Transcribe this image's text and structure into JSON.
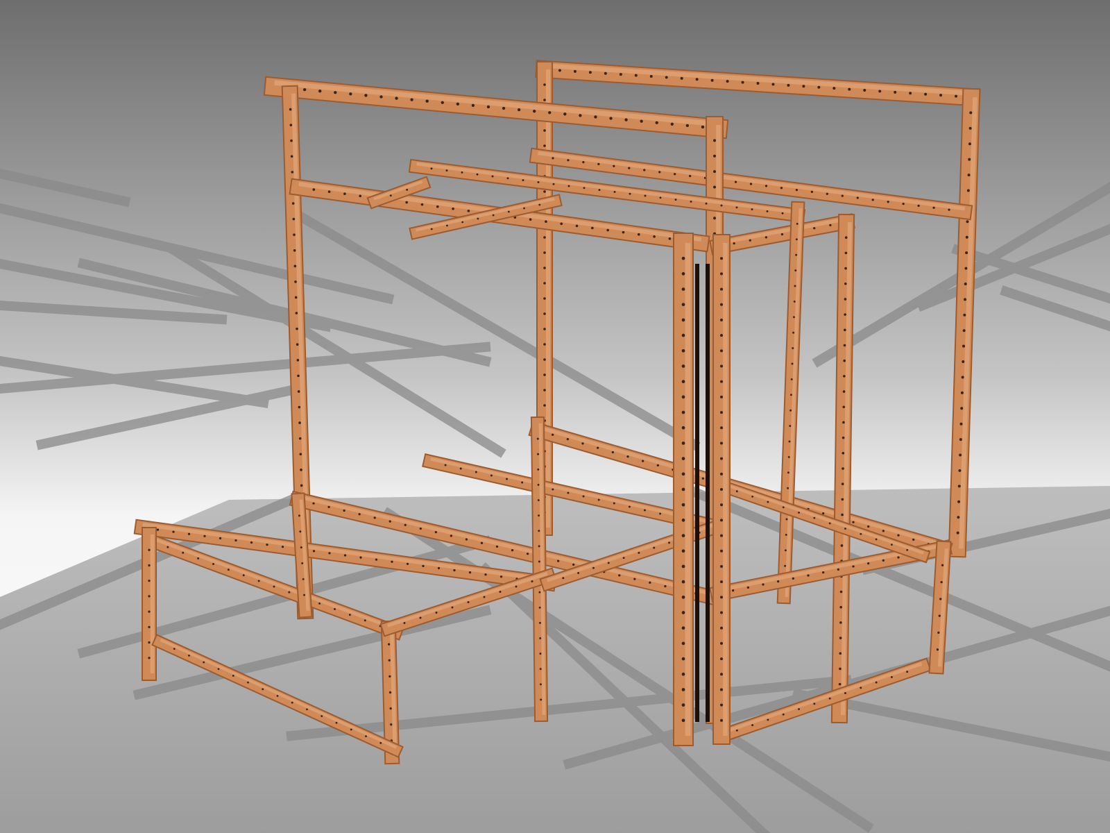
{
  "scene": {
    "subject": "bunk-bed-frame",
    "material": "wood-beam",
    "colors": {
      "wood": "#cf8a58",
      "wood_light": "#e2a679",
      "wood_dark": "#9c5c31",
      "hole": "#3a2314",
      "sky_top": "#6e6e6e",
      "sky_bottom": "#f4f4f4",
      "floor": "#9a9a9a",
      "shadow": "#7d7d7d"
    }
  }
}
